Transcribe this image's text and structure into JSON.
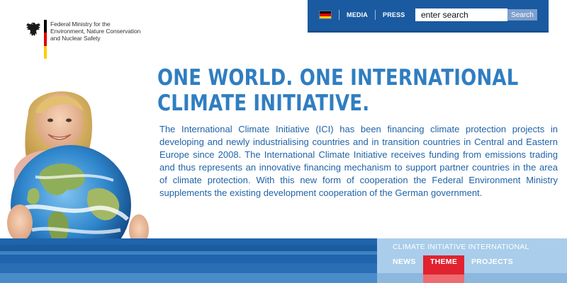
{
  "logo": {
    "ministry_name_lines": [
      "Federal Ministry for the",
      "Environment, Nature Conservation",
      "and Nuclear Safety"
    ],
    "flag_colors": [
      "#000000",
      "#dd0000",
      "#ffcc00"
    ],
    "icon": "federal-eagle-icon"
  },
  "topbar": {
    "language_icon": "german-flag-icon",
    "links": [
      "MEDIA",
      "PRESS"
    ],
    "search": {
      "value": "enter search",
      "button_label": "Search"
    },
    "background": "#1a5aa0"
  },
  "headline": {
    "line1": "ONE WORLD. ONE INTERNATIONAL",
    "line2": "CLIMATE INITIATIVE.",
    "color": "#2f7ec1"
  },
  "intro": {
    "text": "The International Climate Initiative (ICI) has been financing climate protection projects in developing and newly industrialising countries and in transition countries in Central and Eastern Europe since 2008. The International Climate Initiative receives funding from emissions trading and thus represents an innovative financing mechanism to support partner countries in the area of climate protection. With this new form of cooperation the Federal Environment Ministry supplements the existing development cooperation of the German government."
  },
  "hero": {
    "description_icon": "girl-holding-globe-image"
  },
  "bottom_nav": {
    "title": "CLIMATE INITIATIVE INTERNATIONAL",
    "items": [
      {
        "label": "NEWS",
        "active": false
      },
      {
        "label": "THEME",
        "active": true
      },
      {
        "label": "PROJECTS",
        "active": false
      }
    ],
    "active_color": "#e0232f"
  }
}
